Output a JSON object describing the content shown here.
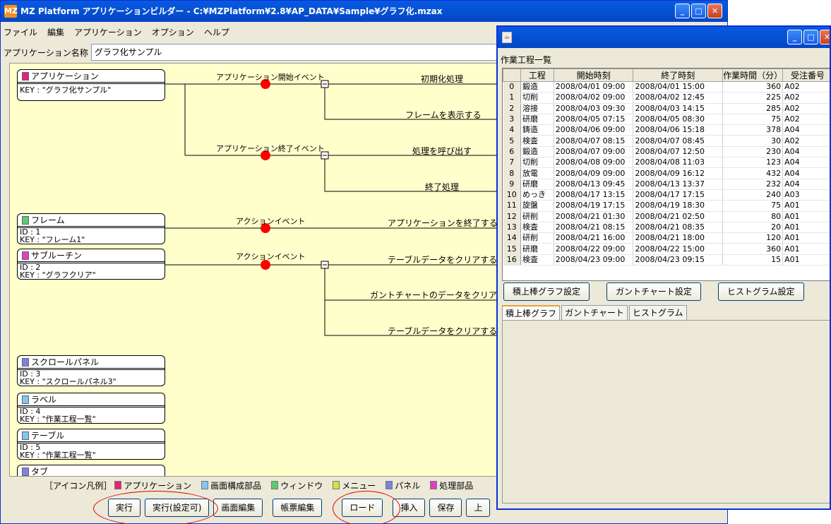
{
  "main_window": {
    "title": "MZ Platform アプリケーションビルダー - C:¥MZPlatform¥2.8¥AP_DATA¥Sample¥グラフ化.mzax",
    "logo": "MZ"
  },
  "menu": [
    "ファイル",
    "編集",
    "アプリケーション",
    "オプション",
    "ヘルプ"
  ],
  "app_name": {
    "label": "アプリケーション名称",
    "value": "グラフ化サンプル"
  },
  "nodes": [
    {
      "title": "アプリケーション",
      "color": "#e8207a",
      "lines": [
        "KEY : \"グラフ化サンプル\""
      ]
    },
    {
      "title": "フレーム",
      "color": "#60c870",
      "lines": [
        "ID : 1",
        "KEY : \"フレーム1\""
      ]
    },
    {
      "title": "サブルーチン",
      "color": "#e040c0",
      "lines": [
        "ID : 2",
        "KEY : \"グラフクリア\""
      ]
    },
    {
      "title": "スクロールパネル",
      "color": "#8080e0",
      "lines": [
        "ID : 3",
        "KEY : \"スクロールパネル3\""
      ]
    },
    {
      "title": "ラベル",
      "color": "#80c8f0",
      "lines": [
        "ID : 4",
        "KEY : \"作業工程一覧\""
      ]
    },
    {
      "title": "テーブル",
      "color": "#80c8f0",
      "lines": [
        "ID : 5",
        "KEY : \"作業工程一覧\""
      ]
    },
    {
      "title": "タブ",
      "color": "#8080e0",
      "lines": []
    }
  ],
  "events": [
    "アプリケーション開始イベント",
    "アプリケーション終了イベント",
    "アクションイベント",
    "アクションイベント"
  ],
  "actions": [
    "初期化処理",
    "フレームを表示する",
    "処理を呼び出す",
    "終了処理",
    "アプリケーションを終了する",
    "テーブルデータをクリアする",
    "ガントチャートのデータをクリア",
    "テーブルデータをクリアする"
  ],
  "legend": {
    "label": "［アイコン凡例］",
    "items": [
      {
        "name": "アプリケーション",
        "color": "#e8207a"
      },
      {
        "name": "画面構成部品",
        "color": "#80c8f0"
      },
      {
        "name": "ウィンドウ",
        "color": "#60c870"
      },
      {
        "name": "メニュー",
        "color": "#d8e040"
      },
      {
        "name": "パネル",
        "color": "#8080e0"
      },
      {
        "name": "処理部品",
        "color": "#e040c0"
      }
    ]
  },
  "buttons": [
    "実行",
    "実行(設定可)",
    "画面編集",
    "帳票編集",
    "ロード",
    "挿入",
    "保存",
    "上"
  ],
  "sub_window": {
    "label": "作業工程一覧",
    "columns": [
      "",
      "工程",
      "開始時刻",
      "終了時刻",
      "作業時間（分）",
      "受注番号"
    ],
    "rows": [
      [
        "0",
        "鍛造",
        "2008/04/01 09:00",
        "2008/04/01 15:00",
        "360",
        "A02"
      ],
      [
        "1",
        "切削",
        "2008/04/02 09:00",
        "2008/04/02 12:45",
        "225",
        "A02"
      ],
      [
        "2",
        "溶接",
        "2008/04/03 09:30",
        "2008/04/03 14:15",
        "285",
        "A02"
      ],
      [
        "3",
        "研磨",
        "2008/04/05 07:15",
        "2008/04/05 08:30",
        "75",
        "A02"
      ],
      [
        "4",
        "鋳造",
        "2008/04/06 09:00",
        "2008/04/06 15:18",
        "378",
        "A04"
      ],
      [
        "5",
        "検査",
        "2008/04/07 08:15",
        "2008/04/07 08:45",
        "30",
        "A02"
      ],
      [
        "6",
        "鍛造",
        "2008/04/07 09:00",
        "2008/04/07 12:50",
        "230",
        "A04"
      ],
      [
        "7",
        "切削",
        "2008/04/08 09:00",
        "2008/04/08 11:03",
        "123",
        "A04"
      ],
      [
        "8",
        "放電",
        "2008/04/09 09:00",
        "2008/04/09 16:12",
        "432",
        "A04"
      ],
      [
        "9",
        "研磨",
        "2008/04/13 09:45",
        "2008/04/13 13:37",
        "232",
        "A04"
      ],
      [
        "10",
        "めっき",
        "2008/04/17 13:15",
        "2008/04/17 17:15",
        "240",
        "A03"
      ],
      [
        "11",
        "旋盤",
        "2008/04/19 17:15",
        "2008/04/19 18:30",
        "75",
        "A01"
      ],
      [
        "12",
        "研削",
        "2008/04/21 01:30",
        "2008/04/21 02:50",
        "80",
        "A01"
      ],
      [
        "13",
        "検査",
        "2008/04/21 08:15",
        "2008/04/21 08:35",
        "20",
        "A01"
      ],
      [
        "14",
        "研削",
        "2008/04/21 16:00",
        "2008/04/21 18:00",
        "120",
        "A01"
      ],
      [
        "15",
        "研磨",
        "2008/04/22 09:00",
        "2008/04/22 15:00",
        "360",
        "A01"
      ],
      [
        "16",
        "検査",
        "2008/04/23 09:00",
        "2008/04/23 09:15",
        "15",
        "A01"
      ]
    ],
    "graph_buttons": [
      "積上棒グラフ設定",
      "ガントチャート設定",
      "ヒストグラム設定"
    ],
    "tabs": [
      "積上棒グラフ",
      "ガントチャート",
      "ヒストグラム"
    ],
    "active_tab": "積上棒グラフ"
  }
}
